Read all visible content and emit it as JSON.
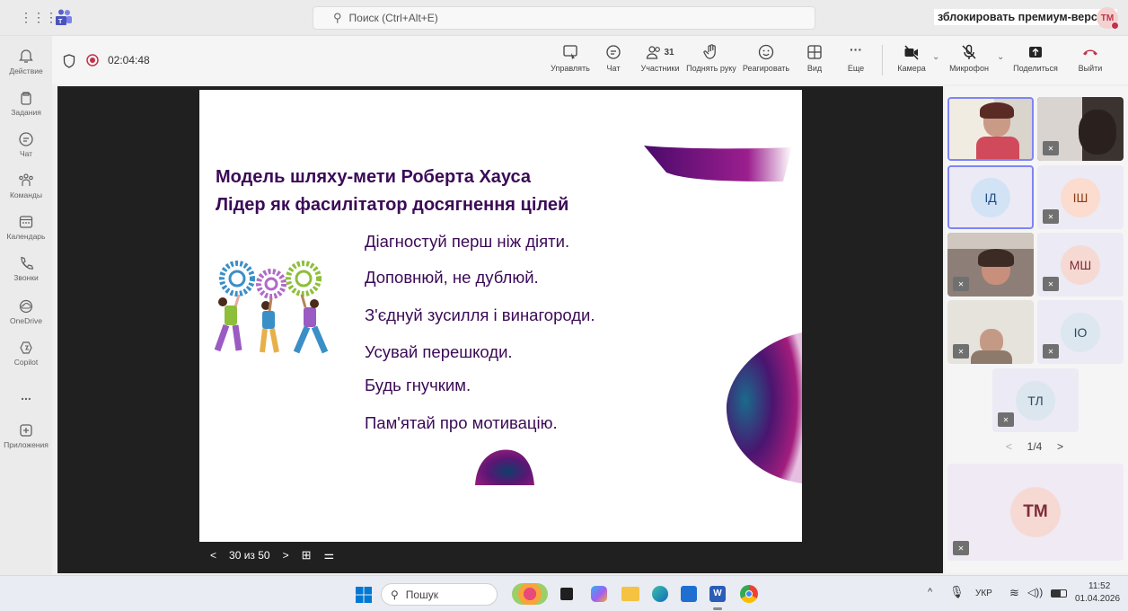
{
  "search": {
    "placeholder": "Поиск (Ctrl+Alt+E)"
  },
  "premium_label": "зблокировать премиум-версию",
  "user_initials": "TM",
  "rail": [
    {
      "label": "Действие",
      "icon": "bell-icon"
    },
    {
      "label": "Задания",
      "icon": "assignments-icon"
    },
    {
      "label": "Чат",
      "icon": "chat-icon"
    },
    {
      "label": "Команды",
      "icon": "teams-icon"
    },
    {
      "label": "Календарь",
      "icon": "calendar-icon"
    },
    {
      "label": "Звонки",
      "icon": "phone-icon"
    },
    {
      "label": "OneDrive",
      "icon": "cloud-icon"
    },
    {
      "label": "Copilot",
      "icon": "copilot-icon"
    },
    {
      "label": "...",
      "icon": "more-icon"
    },
    {
      "label": "Приложения",
      "icon": "add-icon"
    }
  ],
  "meeting": {
    "timer": "02:04:48",
    "toolbar": {
      "manage": "Управлять",
      "chat": "Чат",
      "participants": "Участники",
      "participants_count": "31",
      "raise_hand": "Поднять руку",
      "react": "Реагировать",
      "view": "Вид",
      "more": "Еще",
      "camera": "Камера",
      "mic": "Микрофон",
      "share": "Поделиться",
      "leave": "Выйти"
    }
  },
  "slide": {
    "title1": "Модель шляху-мети Роберта Хауса",
    "title2": "Лідер як фасилітатор досягнення цілей",
    "bullets": [
      "Діагностуй перш ніж діяти.",
      "Доповнюй, не дублюй.",
      "З'єднуй зусилля і винагороди.",
      "Усувай перешкоди.",
      "Будь гнучким.",
      "Пам'ятай про мотивацію."
    ],
    "page": "30 из 50"
  },
  "participants": {
    "tiles": [
      "ІД",
      "ІШ",
      "МШ",
      "ІО",
      "ТЛ",
      "TM"
    ],
    "pager": "1/4"
  },
  "taskbar": {
    "search": "Пошук",
    "lang": "УКР",
    "time": "11:52",
    "date": "01.04.2026"
  },
  "colors": {
    "accent": "#5b5fc7",
    "slide_text": "#3b0a57",
    "leave": "#c4314b"
  }
}
